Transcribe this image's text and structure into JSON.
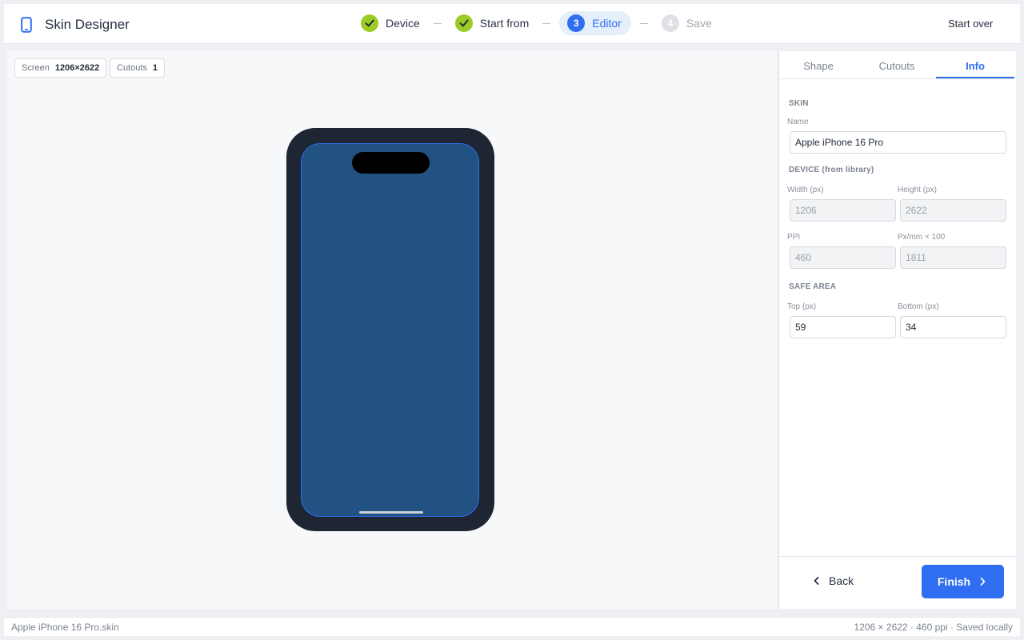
{
  "app": {
    "title": "Skin Designer"
  },
  "steps": [
    {
      "number": "1",
      "label": "Device",
      "state": "done"
    },
    {
      "number": "2",
      "label": "Start from",
      "state": "done"
    },
    {
      "number": "3",
      "label": "Editor",
      "state": "active"
    },
    {
      "number": "4",
      "label": "Save",
      "state": "pending"
    }
  ],
  "header": {
    "start_over": "Start over"
  },
  "canvas": {
    "chips": [
      {
        "label": "Screen",
        "value": "1206×2622"
      },
      {
        "label": "Cutouts",
        "value": "1"
      }
    ]
  },
  "panel": {
    "tabs": [
      {
        "label": "Shape",
        "active": false
      },
      {
        "label": "Cutouts",
        "active": false
      },
      {
        "label": "Info",
        "active": true
      }
    ],
    "skin": {
      "heading": "SKIN",
      "name_label": "Name",
      "name_value": "Apple iPhone 16 Pro"
    },
    "device": {
      "heading": "DEVICE (from library)",
      "width_label": "Width (px)",
      "width_value": "1206",
      "height_label": "Height (px)",
      "height_value": "2622",
      "ppi_label": "PPI",
      "ppi_value": "460",
      "pxmm_label": "Px/mm × 100",
      "pxmm_value": "1811"
    },
    "safe_area": {
      "heading": "SAFE AREA",
      "top_label": "Top (px)",
      "top_value": "59",
      "bottom_label": "Bottom (px)",
      "bottom_value": "34"
    },
    "back_label": "Back",
    "finish_label": "Finish"
  },
  "status": {
    "filename": "Apple iPhone 16 Pro.skin",
    "summary": "1206 × 2622 · 460 ppi · Saved locally"
  },
  "colors": {
    "accent": "#2f6ef0",
    "done": "#9ccb25",
    "bezel": "#1e2533",
    "screen": "#225282"
  },
  "icons": {
    "app": "phone-icon",
    "done_step": "check-icon",
    "back": "chevron-left-icon",
    "finish": "chevron-right-icon"
  }
}
